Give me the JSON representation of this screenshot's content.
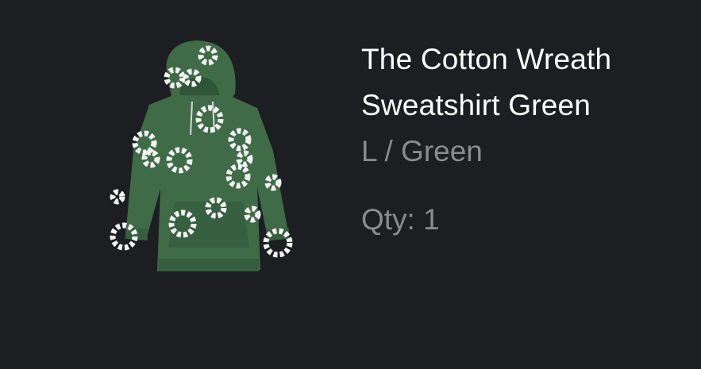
{
  "product": {
    "title_line1": "The Cotton Wreath",
    "title_line2": "Sweatshirt Green",
    "variant": "L / Green",
    "qty_label": "Qty:",
    "qty_value": "1"
  },
  "image": {
    "icon": "hoodie-product-image",
    "garment_color": "#3f6b47",
    "print_color": "#f2f2f2"
  },
  "colors": {
    "background": "#1d1e22",
    "title_text": "#ffffff",
    "secondary_text": "#8a8b8f"
  }
}
